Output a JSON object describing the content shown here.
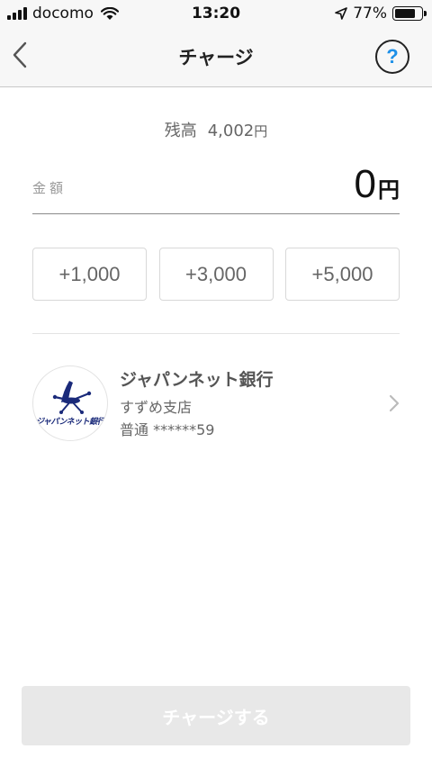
{
  "status_bar": {
    "carrier": "docomo",
    "time": "13:20",
    "battery": "77%",
    "battery_level": 0.77,
    "icons": [
      "signal-icon",
      "wifi-icon",
      "location-arrow-icon",
      "battery-icon"
    ]
  },
  "nav": {
    "title": "チャージ",
    "back_icon": "chevron-left-icon",
    "help_label": "?",
    "help_color": "#1e90e8"
  },
  "balance": {
    "label": "残高",
    "amount": "4,002",
    "unit": "円"
  },
  "amount": {
    "label": "金額",
    "value": "0",
    "unit": "円"
  },
  "quick_buttons": [
    {
      "label": "+1,000"
    },
    {
      "label": "+3,000"
    },
    {
      "label": "+5,000"
    }
  ],
  "bank": {
    "logo_text": "ジャパンネット銀行",
    "name": "ジャパンネット銀行",
    "branch": "すずめ支店",
    "account": "普通 ******59",
    "logo_color": "#1a2a7a"
  },
  "charge_button": {
    "label": "チャージする",
    "background": "#e8e8e8"
  }
}
